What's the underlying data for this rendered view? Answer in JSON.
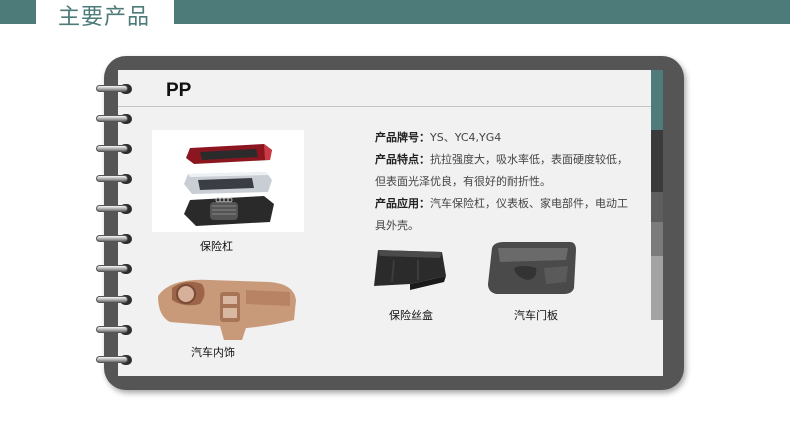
{
  "header": {
    "title": "主要产品"
  },
  "card": {
    "title": "PP"
  },
  "products": {
    "bumper": "保险杠",
    "interior": "汽车内饰",
    "fuse_box": "保险丝盒",
    "door_panel": "汽车门板"
  },
  "info": {
    "grade_label": "产品牌号：",
    "grade_value": "YS、YC4,YG4",
    "feature_label": "产品特点：",
    "feature_value": "抗拉强度大，吸水率低，表面硬度较低，但表面光泽优良，有很好的耐折性。",
    "use_label": "产品应用：",
    "use_value": "汽车保险杠，仪表板、家电部件，电动工具外壳。"
  },
  "colors": {
    "accent": "#4c7b7a",
    "tabs": [
      "#4f7c7a",
      "#3a3a3a",
      "#5e5e5e",
      "#7b7b7b",
      "#a3a3a3"
    ]
  }
}
